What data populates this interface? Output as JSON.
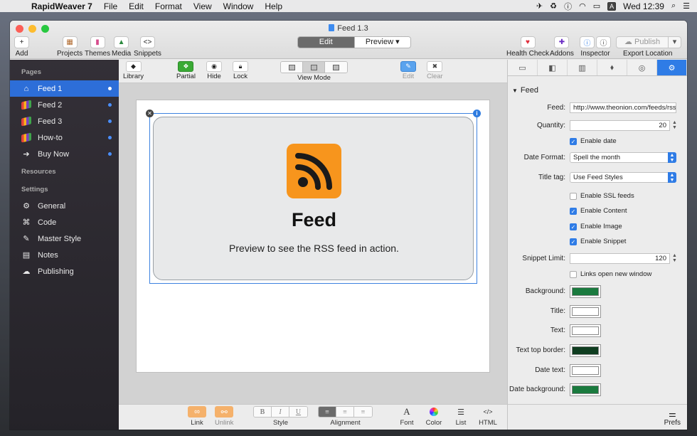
{
  "menubar": {
    "app": "RapidWeaver 7",
    "menus": [
      "File",
      "Edit",
      "Format",
      "View",
      "Window",
      "Help"
    ],
    "input_badge": "A",
    "clock": "Wed 12:39"
  },
  "window": {
    "title": "Feed 1.3",
    "toolbar": {
      "add": "Add",
      "projects": "Projects",
      "themes": "Themes",
      "media": "Media",
      "snippets": "Snippets",
      "edit": "Edit",
      "preview": "Preview",
      "health_check": "Health Check",
      "addons": "Addons",
      "inspector": "Inspector",
      "publish": "Publish",
      "export_location": "Export Location"
    }
  },
  "sidebar": {
    "pages_header": "Pages",
    "pages": [
      {
        "label": "Feed 1"
      },
      {
        "label": "Feed 2"
      },
      {
        "label": "Feed 3"
      },
      {
        "label": "How-to"
      },
      {
        "label": "Buy Now"
      }
    ],
    "resources_header": "Resources",
    "settings_header": "Settings",
    "settings": [
      {
        "label": "General"
      },
      {
        "label": "Code"
      },
      {
        "label": "Master Style"
      },
      {
        "label": "Notes"
      },
      {
        "label": "Publishing"
      }
    ]
  },
  "center_toolbar": {
    "library": "Library",
    "partial": "Partial",
    "hide": "Hide",
    "lock": "Lock",
    "view_mode": "View Mode",
    "edit": "Edit",
    "clear": "Clear"
  },
  "canvas": {
    "feed_title": "Feed",
    "feed_desc": "Preview to see the RSS feed in action."
  },
  "format_bar": {
    "link": "Link",
    "unlink": "Unlink",
    "style": "Style",
    "bold": "B",
    "italic": "I",
    "underline": "U",
    "alignment": "Alignment",
    "font_glyph": "A",
    "font": "Font",
    "color": "Color",
    "list": "List",
    "html": "HTML"
  },
  "inspector": {
    "section": "Feed",
    "feed_label": "Feed:",
    "feed_value": "http://www.theonion.com/feeds/rss",
    "quantity_label": "Quantity:",
    "quantity_value": "20",
    "enable_date": "Enable date",
    "date_format_label": "Date Format:",
    "date_format_value": "Spell the month",
    "title_tag_label": "Title tag:",
    "title_tag_value": "Use Feed Styles",
    "enable_ssl": "Enable SSL feeds",
    "enable_content": "Enable Content",
    "enable_image": "Enable Image",
    "enable_snippet": "Enable Snippet",
    "snippet_limit_label": "Snippet Limit:",
    "snippet_limit_value": "120",
    "links_new_window": "Links open new window",
    "background_label": "Background:",
    "title_label": "Title:",
    "text_label": "Text:",
    "text_top_border_label": "Text top border:",
    "date_text_label": "Date text:",
    "date_background_label": "Date background:",
    "prefs": "Prefs",
    "colors": {
      "background": "#1a7a3e",
      "title": "#ffffff",
      "text": "#ffffff",
      "text_top_border": "#0f3d20",
      "date_text": "#ffffff",
      "date_background": "#1a7a3e"
    }
  },
  "colors": {
    "accent": "#2f7ce6",
    "rss_orange": "#f7951d"
  }
}
